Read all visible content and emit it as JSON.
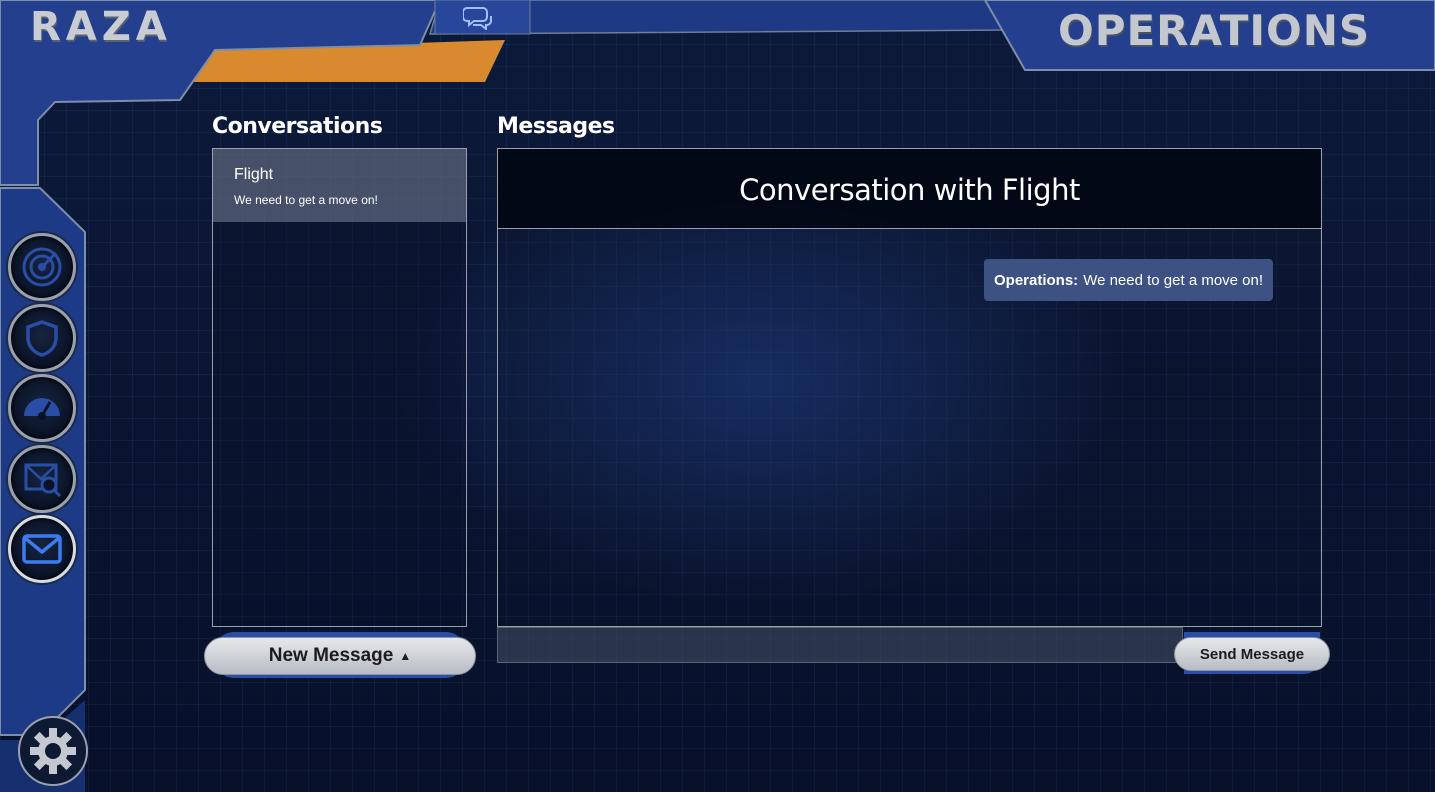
{
  "app": {
    "brand": "RAZA",
    "section_title": "OPERATIONS"
  },
  "colors": {
    "accent_blue": "#2a4ea6",
    "accent_orange": "#d98a2e",
    "bubble": "#3d5283",
    "nav_active": "#3b7cf0"
  },
  "nav": {
    "items": [
      {
        "icon": "radar-icon"
      },
      {
        "icon": "shield-icon"
      },
      {
        "icon": "gauge-icon"
      },
      {
        "icon": "inspect-icon"
      },
      {
        "icon": "mail-icon",
        "active": true
      }
    ],
    "settings_icon": "gear-icon"
  },
  "conversations": {
    "label": "Conversations",
    "items": [
      {
        "name": "Flight",
        "preview": "We need to get a move on!",
        "selected": true
      }
    ],
    "new_button": "New Message"
  },
  "messages": {
    "label": "Messages",
    "header": "Conversation with Flight",
    "items": [
      {
        "sender": "Operations:",
        "text": "We need to get a move on!"
      }
    ],
    "input_placeholder": "",
    "send_button": "Send Message"
  }
}
